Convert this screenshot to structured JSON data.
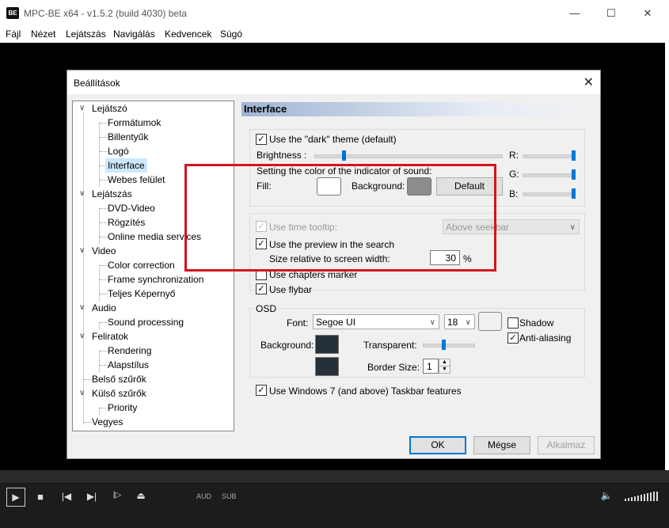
{
  "app": {
    "title": "MPC-BE x64 - v1.5.2 (build 4030) beta",
    "icon_text": "BE",
    "menu": [
      "Fájl",
      "Nézet",
      "Lejátszás",
      "Navigálás",
      "Kedvencek",
      "Súgó"
    ],
    "controls": {
      "aud": "AUD",
      "sub": "SUB"
    }
  },
  "dialog": {
    "title": "Beállítások",
    "tree": [
      {
        "label": "Lejátszó",
        "level": 0
      },
      {
        "label": "Formátumok",
        "level": 1
      },
      {
        "label": "Billentyűk",
        "level": 1
      },
      {
        "label": "Logó",
        "level": 1
      },
      {
        "label": "Interface",
        "level": 1,
        "selected": true
      },
      {
        "label": "Webes felület",
        "level": 1
      },
      {
        "label": "Lejátszás",
        "level": 0
      },
      {
        "label": "DVD-Video",
        "level": 1
      },
      {
        "label": "Rögzítés",
        "level": 1
      },
      {
        "label": "Online media services",
        "level": 1
      },
      {
        "label": "Video",
        "level": 0
      },
      {
        "label": "Color correction",
        "level": 1
      },
      {
        "label": "Frame synchronization",
        "level": 1
      },
      {
        "label": "Teljes Képernyő",
        "level": 1
      },
      {
        "label": "Audio",
        "level": 0
      },
      {
        "label": "Sound processing",
        "level": 1
      },
      {
        "label": "Feliratok",
        "level": 0
      },
      {
        "label": "Rendering",
        "level": 1
      },
      {
        "label": "Alapstílus",
        "level": 1
      },
      {
        "label": "Belső szűrők",
        "level": 0,
        "leaf": true
      },
      {
        "label": "Külső szűrők",
        "level": 0
      },
      {
        "label": "Priority",
        "level": 1
      },
      {
        "label": "Vegyes",
        "level": 0,
        "leaf": true
      }
    ],
    "panel": {
      "header": "Interface",
      "dark_theme_label": "Use the \"dark\" theme (default)",
      "dark_theme_checked": true,
      "brightness_label": "Brightness :",
      "brightness_level": 0.12,
      "sound_indicator_label": "Setting the color of the indicator of sound:",
      "fill_label": "Fill:",
      "background_label": "Background:",
      "default_button": "Default",
      "rgb": {
        "r_label": "R:",
        "g_label": "G:",
        "b_label": "B:",
        "r": 1.0,
        "g": 1.0,
        "b": 1.0
      },
      "fill_color": "#ffffff",
      "background_color": "#8c8c8c",
      "time_tooltip_label": "Use time tooltip:",
      "time_tooltip_option": "Above seekbar",
      "preview_label": "Use the preview in the search",
      "preview_checked": true,
      "size_relative_label": "Size relative to screen width:",
      "size_relative_value": "30",
      "size_relative_unit": "%",
      "chapters_label": "Use chapters marker",
      "flybar_label": "Use flybar",
      "flybar_checked": true,
      "osd": {
        "legend": "OSD",
        "font_label": "Font:",
        "font_value": "Segoe UI",
        "size_value": "18",
        "shadow_label": "Shadow",
        "antialias_label": "Anti-aliasing",
        "antialias_checked": true,
        "background_label": "Background:",
        "transparent_label": "Transparent:",
        "transparent_level": 0.4,
        "border_size_label": "Border Size:",
        "border_size_value": "1",
        "swatch_color": "#263039",
        "font_color": "#f0f0f0"
      },
      "taskbar_label": "Use Windows 7 (and above) Taskbar features",
      "taskbar_checked": true
    },
    "buttons": {
      "ok": "OK",
      "cancel": "Mégse",
      "apply": "Alkalmaz"
    }
  },
  "colors": {
    "highlight": "#d5141b",
    "accent": "#0078d7"
  }
}
